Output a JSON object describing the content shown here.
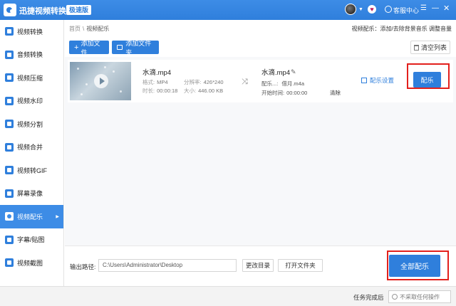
{
  "titlebar": {
    "app_title": "迅捷视频转换器",
    "edition": "极速版",
    "service": "客服中心",
    "vip_glyph": "♥"
  },
  "sidebar": {
    "items": [
      {
        "label": "视频转换",
        "icon": "video-convert-icon"
      },
      {
        "label": "音频转换",
        "icon": "audio-convert-icon"
      },
      {
        "label": "视频压缩",
        "icon": "video-compress-icon"
      },
      {
        "label": "视频水印",
        "icon": "video-watermark-icon"
      },
      {
        "label": "视频分割",
        "icon": "video-split-icon"
      },
      {
        "label": "视频合并",
        "icon": "video-merge-icon"
      },
      {
        "label": "视频转GIF",
        "icon": "video-gif-icon"
      },
      {
        "label": "屏幕录像",
        "icon": "screen-record-icon"
      },
      {
        "label": "视频配乐",
        "icon": "video-music-icon",
        "active": true
      },
      {
        "label": "字幕/贴图",
        "icon": "subtitle-icon"
      },
      {
        "label": "视频截图",
        "icon": "screenshot-icon"
      }
    ]
  },
  "breadcrumb": {
    "home": "首页",
    "sep": "\\",
    "current": "视频配乐"
  },
  "header_hint": "视频配乐：添加/去除背景音乐 调整音量",
  "toolbar": {
    "add_file": "添加文件",
    "add_folder": "添加文件夹",
    "clear_list": "清空列表"
  },
  "file": {
    "name": "水滴.mp4",
    "format_label": "格式:",
    "format": "MP4",
    "resolution_label": "分辨率:",
    "resolution": "426*240",
    "duration_label": "时长:",
    "duration": "00:00:18",
    "size_label": "大小:",
    "size": "446.00 KB",
    "output_name": "水滴.mp4",
    "music_label": "配乐...:",
    "music": "借月.m4a",
    "start_label": "开始时间:",
    "start": "00:00:00",
    "clear_link": "清除",
    "settings_link": "配乐设置",
    "score_button": "配乐"
  },
  "output": {
    "label": "输出路径:",
    "path": "C:\\Users\\Administrator\\Desktop",
    "change_dir": "更改目录",
    "open_folder": "打开文件夹",
    "all_button": "全部配乐"
  },
  "status": {
    "after_label": "任务完成后",
    "after_value": "不采取任何操作"
  },
  "colors": {
    "accent": "#2f7fdc",
    "highlight": "#e3201c"
  }
}
